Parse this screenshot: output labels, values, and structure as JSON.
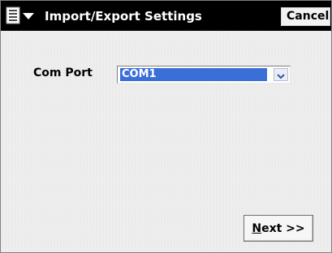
{
  "window": {
    "title": "Import/Export Settings",
    "menu_icon": "start-menu-icon",
    "cancel_label": "Cancel"
  },
  "form": {
    "com_port_label": "Com Port",
    "com_port_value": "COM1",
    "dropdown_icon": "chevron-down-icon"
  },
  "footer": {
    "next_accel": "N",
    "next_rest": "ext >>"
  },
  "colors": {
    "titlebar": "#000000",
    "selection": "#3a6fd8",
    "background": "#eeeeee"
  }
}
